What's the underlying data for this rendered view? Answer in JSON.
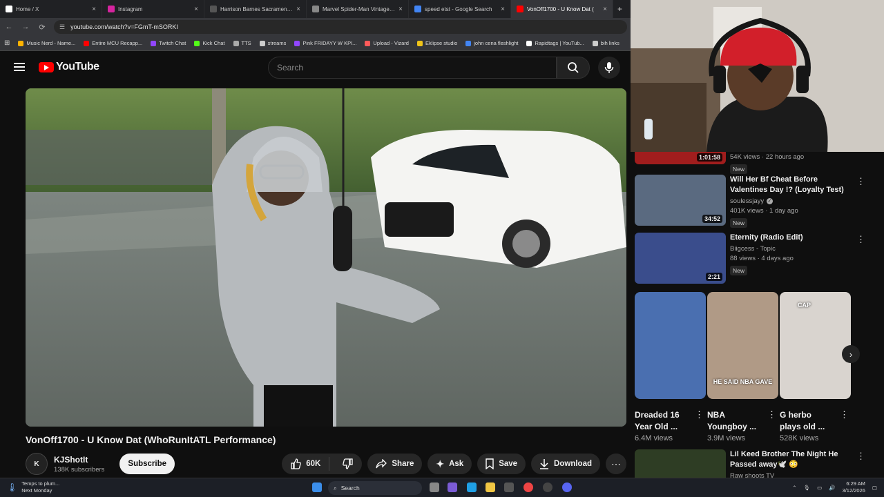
{
  "browser": {
    "tabs": [
      {
        "label": "Home / X",
        "icon": "x-logo-icon",
        "color": "#ffffff"
      },
      {
        "label": "Instagram",
        "icon": "instagram-icon",
        "color": "#d6249f"
      },
      {
        "label": "Harrison Barnes Sacramento Ki",
        "icon": "nba-icon",
        "color": "#555555"
      },
      {
        "label": "Marvel Spider-Man Vintage Co",
        "icon": "ebay-icon",
        "color": "#888888"
      },
      {
        "label": "speed etst - Google Search",
        "icon": "google-icon",
        "color": "#4285f4"
      },
      {
        "label": "VonOff1700 - U Know Dat (",
        "icon": "youtube-icon",
        "color": "#ff0000"
      }
    ],
    "url": "youtube.com/watch?v=FGmT-mSORKI",
    "bookmarks": [
      {
        "label": "Music Nerd - Name...",
        "color": "#ffb300"
      },
      {
        "label": "Entire MCU Recapp...",
        "color": "#ff0000"
      },
      {
        "label": "Twitch Chat",
        "color": "#9146ff"
      },
      {
        "label": "Kick Chat",
        "color": "#53fc18"
      },
      {
        "label": "TTS",
        "color": "#aaaaaa"
      },
      {
        "label": "streams",
        "color": "#cccccc"
      },
      {
        "label": "Pink FRIDAYY W KPI...",
        "color": "#9146ff"
      },
      {
        "label": "Upload - Vizard",
        "color": "#ff5a5a"
      },
      {
        "label": "Eklipse studio",
        "color": "#f0c419"
      },
      {
        "label": "john cena fleshlight",
        "color": "#4285f4"
      },
      {
        "label": "Rapidtags | YouTub...",
        "color": "#ffffff"
      },
      {
        "label": "bih links",
        "color": "#cccccc"
      }
    ]
  },
  "youtube": {
    "logo_text": "YouTube",
    "search_placeholder": "Search",
    "video_title": "VonOff1700 - U Know Dat (WhoRunItATL Performance)",
    "channel": {
      "name": "KJShotIt",
      "subscribers": "138K subscribers",
      "avatar_text": "K"
    },
    "subscribe_label": "Subscribe",
    "likes": "60K",
    "share_label": "Share",
    "ask_label": "Ask",
    "save_label": "Save",
    "download_label": "Download"
  },
  "sidebar": {
    "partial": {
      "duration": "1:01:58",
      "stats": "54K views · 22 hours ago",
      "badge": "New"
    },
    "videos": [
      {
        "title": "Will Her Bf Cheat Before Valentines Day !? (Loyalty Test)",
        "channel": "soulessjayy",
        "verified": true,
        "stats": "401K views · 1 day ago",
        "badge": "New",
        "duration": "34:52",
        "color": "#5a6a80"
      },
      {
        "title": "Eternity (Radio Edit)",
        "channel": "Biigcess - Topic",
        "verified": false,
        "stats": "88 views · 4 days ago",
        "badge": "New",
        "duration": "2:21",
        "color": "#3a4d8c"
      }
    ],
    "shorts": [
      {
        "title": "Dreaded 16 Year Old ...",
        "views": "6.4M views",
        "overlay": "",
        "color": "#4a6fb0"
      },
      {
        "title": "NBA Youngboy ...",
        "views": "3.9M views",
        "overlay": "HE SAID NBA GAVE",
        "color": "#b09a86"
      },
      {
        "title": "G herbo plays old ...",
        "views": "528K views",
        "overlay": "CAP",
        "color": "#d9d4cf"
      }
    ],
    "bottom": {
      "title": "Lil Keed Brother The Night He Passed away🕊️ 😳",
      "channel": "Raw shoots TV"
    }
  },
  "taskbar": {
    "weather_line1": "Temps to plum...",
    "weather_line2": "Next Monday",
    "search_label": "Search",
    "time": "6:29 AM",
    "date": "3/12/2026"
  }
}
